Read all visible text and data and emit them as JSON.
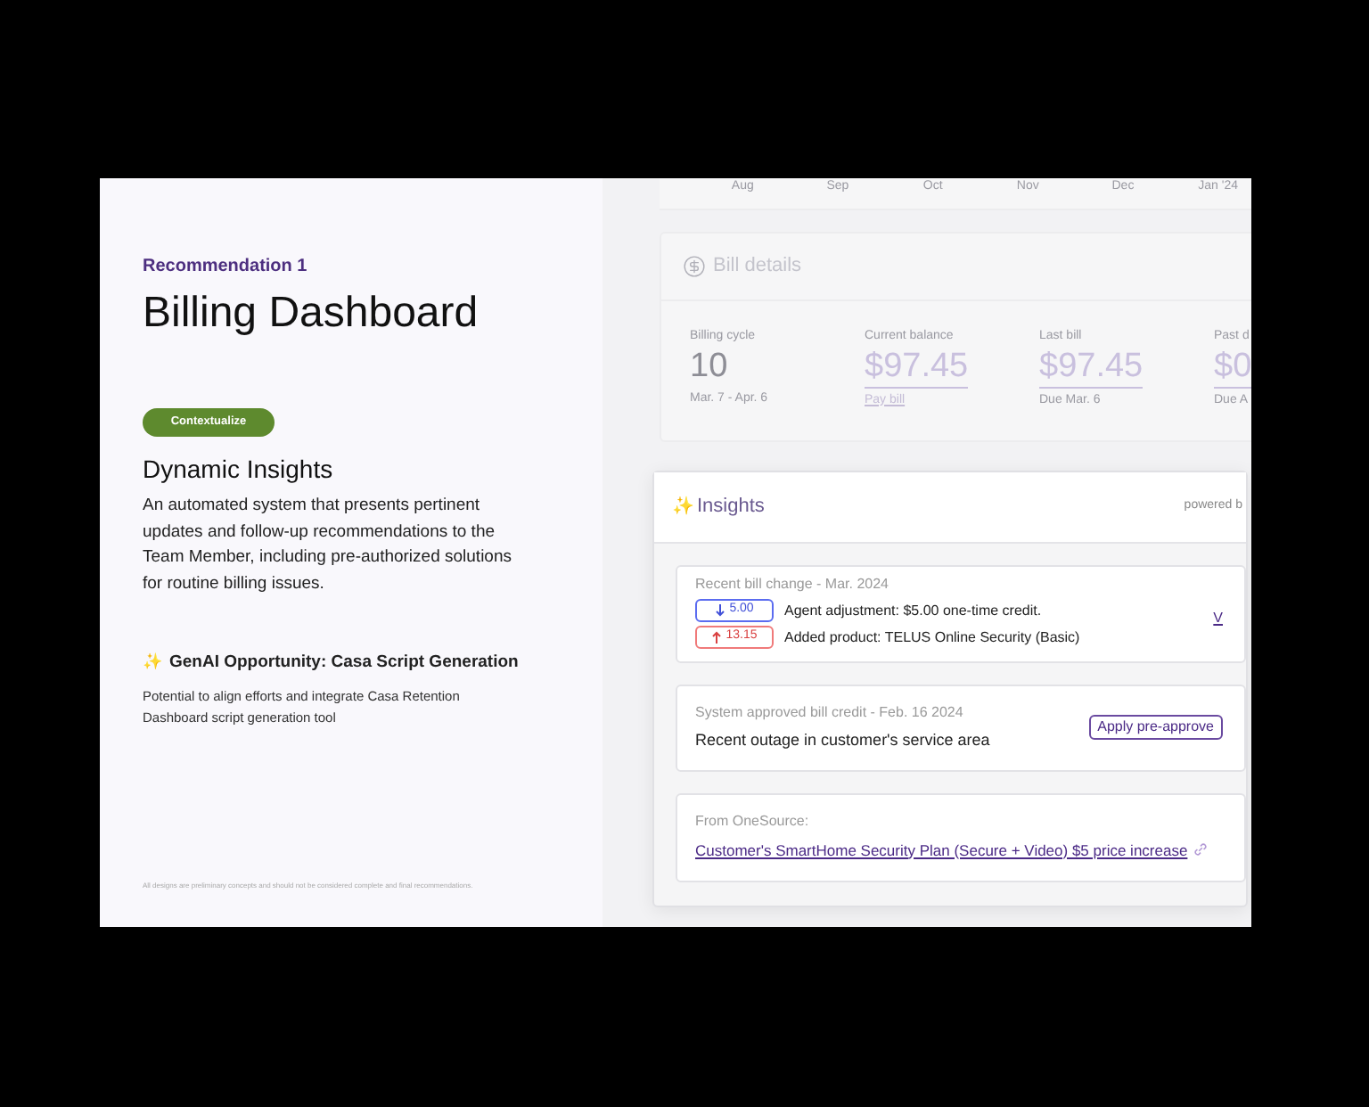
{
  "left": {
    "eyebrow": "Recommendation 1",
    "title": "Billing Dashboard",
    "tag": "Contextualize",
    "heading": "Dynamic Insights",
    "description": "An automated system that presents pertinent updates and follow-up recommendations to the Team Member, including pre-authorized solutions for routine billing issues.",
    "opportunity_icon": "✨",
    "opportunity_title": "GenAI Opportunity: Casa Script Generation",
    "opportunity_text": "Potential to align efforts and integrate Casa Retention Dashboard script generation tool",
    "footnote": "All designs are preliminary concepts and should not be considered complete and final recommendations."
  },
  "dashboard": {
    "months": [
      "Aug",
      "Sep",
      "Oct",
      "Nov",
      "Dec",
      "Jan '24"
    ],
    "bill_details": {
      "title": "Bill details",
      "stats": [
        {
          "label": "Billing cycle",
          "value": "10",
          "note": "Mar. 7 - Apr. 6",
          "kind": "plain"
        },
        {
          "label": "Current balance",
          "value": "$97.45",
          "note": "Pay bill",
          "kind": "link"
        },
        {
          "label": "Last bill",
          "value": "$97.45",
          "note": "Due Mar. 6",
          "kind": "amount"
        },
        {
          "label": "Past d",
          "value": "$0",
          "note": "Due A",
          "kind": "amount"
        }
      ]
    },
    "insights": {
      "icon": "✨",
      "title": "Insights",
      "powered": "powered b",
      "cards": [
        {
          "kind": "changes",
          "caption": "Recent bill change - Mar. 2024",
          "link": "V",
          "changes": [
            {
              "kind": "decrease",
              "amount": "5.00",
              "text": "Agent adjustment: $5.00 one-time credit."
            },
            {
              "kind": "increase",
              "amount": "13.15",
              "text": "Added product: TELUS Online Security (Basic)"
            }
          ]
        },
        {
          "kind": "credit",
          "caption": "System approved bill credit - Feb. 16 2024",
          "text": "Recent outage in customer's service area",
          "button": "Apply pre-approve"
        },
        {
          "kind": "source",
          "caption": "From OneSource:",
          "link": "Customer's SmartHome Security Plan (Secure + Video) $5 price increase"
        }
      ]
    }
  }
}
